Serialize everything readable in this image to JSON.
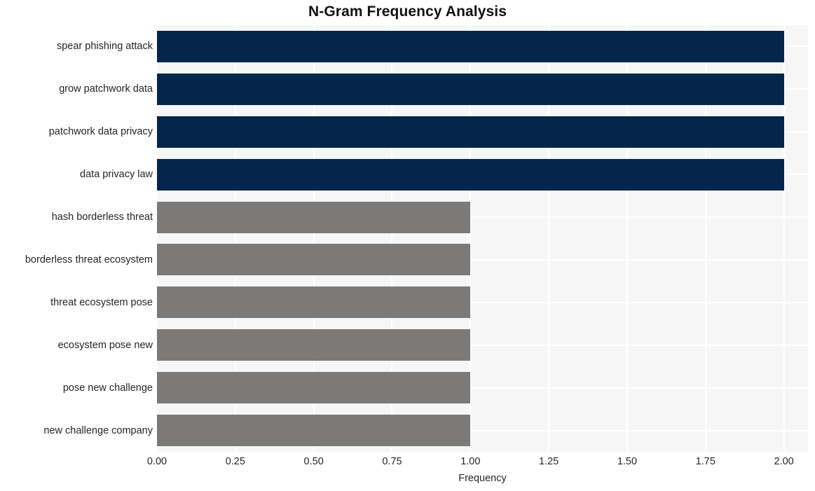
{
  "chart_data": {
    "type": "bar",
    "orientation": "horizontal",
    "title": "N-Gram Frequency Analysis",
    "xlabel": "Frequency",
    "ylabel": "",
    "categories": [
      "spear phishing attack",
      "grow patchwork data",
      "patchwork data privacy",
      "data privacy law",
      "hash borderless threat",
      "borderless threat ecosystem",
      "threat ecosystem pose",
      "ecosystem pose new",
      "pose new challenge",
      "new challenge company"
    ],
    "values": [
      2,
      2,
      2,
      2,
      1,
      1,
      1,
      1,
      1,
      1
    ],
    "bar_colors": [
      "#04254c",
      "#04254c",
      "#04254c",
      "#04254c",
      "#7c7a78",
      "#7c7a78",
      "#7c7a78",
      "#7c7a78",
      "#7c7a78",
      "#7c7a78"
    ],
    "xlim": [
      0,
      2.0768
    ],
    "xticks": [
      0.0,
      0.25,
      0.5,
      0.75,
      1.0,
      1.25,
      1.5,
      1.75,
      2.0
    ],
    "xtick_labels": [
      "0.00",
      "0.25",
      "0.50",
      "0.75",
      "1.00",
      "1.25",
      "1.50",
      "1.75",
      "2.00"
    ],
    "grid": true,
    "grid_color": "#ffffff",
    "plot_background": "#f6f6f6",
    "figure_background": "#ffffff",
    "legend": null,
    "annotations": []
  },
  "colors": {
    "navy": "#04254c",
    "gray": "#7c7a78",
    "text": "#262626",
    "title": "#111111"
  }
}
